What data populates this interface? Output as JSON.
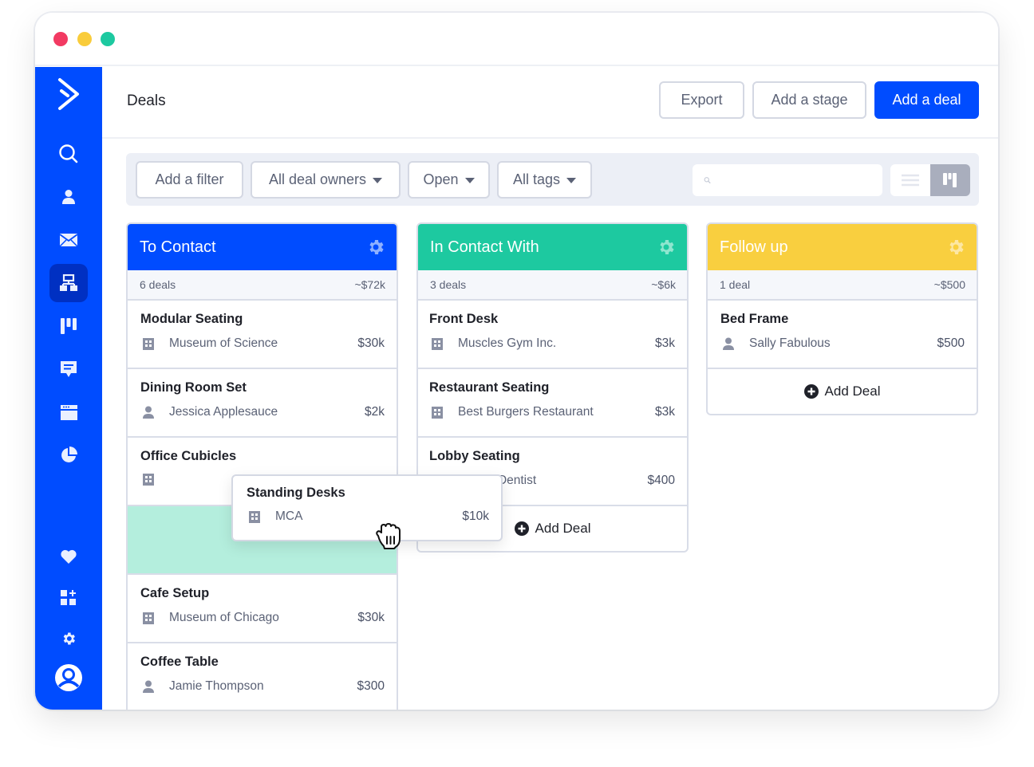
{
  "window": {
    "controls": [
      "close",
      "minimize",
      "maximize"
    ],
    "control_colors": {
      "close": "#f23a62",
      "minimize": "#f9cc3b",
      "maximize": "#1dc9a0"
    }
  },
  "sidebar": {
    "logo": "activecampaign-chevron-logo",
    "items": [
      {
        "name": "search",
        "icon": "search-icon"
      },
      {
        "name": "contacts",
        "icon": "person-icon"
      },
      {
        "name": "campaigns",
        "icon": "envelope-icon"
      },
      {
        "name": "automations",
        "icon": "sitemap-icon",
        "active": true
      },
      {
        "name": "deals",
        "icon": "kanban-icon"
      },
      {
        "name": "conversations",
        "icon": "chat-icon"
      },
      {
        "name": "site",
        "icon": "browser-window-icon"
      },
      {
        "name": "reports",
        "icon": "pie-chart-icon"
      }
    ],
    "bottom_items": [
      {
        "name": "favorites",
        "icon": "heart-icon"
      },
      {
        "name": "apps",
        "icon": "apps-add-icon"
      },
      {
        "name": "settings",
        "icon": "gear-icon"
      },
      {
        "name": "account",
        "icon": "user-avatar-icon"
      }
    ],
    "bg_color": "#004cff"
  },
  "header": {
    "title": "Deals",
    "export_label": "Export",
    "add_stage_label": "Add a stage",
    "add_deal_label": "Add a deal"
  },
  "filters": {
    "add_filter_label": "Add a filter",
    "owners_label": "All deal owners",
    "status_label": "Open",
    "tags_label": "All tags",
    "search_value": "",
    "search_placeholder": "",
    "view_mode": "board"
  },
  "stages": [
    {
      "title": "To Contact",
      "color": "#004cff",
      "count_label": "6 deals",
      "total": "~$72k",
      "deals": [
        {
          "title": "Modular Seating",
          "contact_type": "organization",
          "contact": "Museum of Science",
          "amount": "$30k"
        },
        {
          "title": "Dining Room Set",
          "contact_type": "person",
          "contact": "Jessica Applesauce",
          "amount": "$2k"
        },
        {
          "title": "Office Cubicles",
          "contact_type": "organization",
          "contact": "",
          "amount": ""
        },
        {
          "title": "Cafe Setup",
          "contact_type": "organization",
          "contact": "Museum of Chicago",
          "amount": "$30k"
        },
        {
          "title": "Coffee Table",
          "contact_type": "person",
          "contact": "Jamie Thompson",
          "amount": "$300"
        }
      ]
    },
    {
      "title": "In Contact With",
      "color": "#1dc9a0",
      "count_label": "3 deals",
      "total": "~$6k",
      "deals": [
        {
          "title": "Front Desk",
          "contact_type": "organization",
          "contact": "Muscles Gym Inc.",
          "amount": "$3k"
        },
        {
          "title": "Restaurant Seating",
          "contact_type": "organization",
          "contact": "Best Burgers Restaurant",
          "amount": "$3k"
        },
        {
          "title": "Lobby Seating",
          "contact_type": "organization",
          "contact": "Family Dentist",
          "amount": "$400"
        }
      ],
      "add_label": "Add Deal"
    },
    {
      "title": "Follow up",
      "color": "#f9cf3f",
      "count_label": "1 deal",
      "total": "~$500",
      "deals": [
        {
          "title": "Bed Frame",
          "contact_type": "person",
          "contact": "Sally Fabulous",
          "amount": "$500"
        }
      ],
      "add_label": "Add Deal"
    }
  ],
  "dragging_card": {
    "title": "Standing Desks",
    "contact_type": "organization",
    "contact": "MCA",
    "amount": "$10k",
    "cursor": "grab-hand-cursor"
  }
}
